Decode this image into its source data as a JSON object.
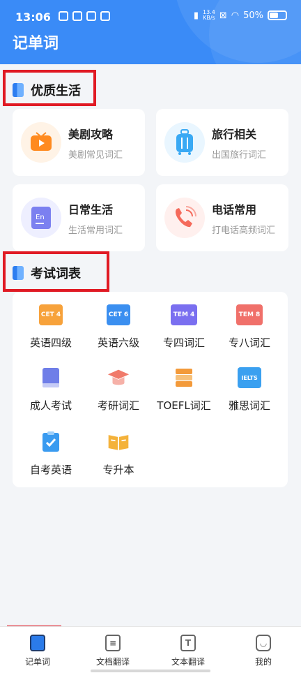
{
  "status": {
    "time": "13:06",
    "speed_top": "13.4",
    "speed_unit": "KB/s",
    "battery": "50%"
  },
  "app_title": "记单词",
  "section_quality": {
    "title": "优质生活"
  },
  "cards": [
    {
      "title": "美剧攻略",
      "subtitle": "美剧常见词汇",
      "icon": "tv-play-icon",
      "bg": "#fff3e6",
      "accent": "#ff8a1f"
    },
    {
      "title": "旅行相关",
      "subtitle": "出国旅行词汇",
      "icon": "suitcase-icon",
      "bg": "#e9f6ff",
      "accent": "#39a9f4"
    },
    {
      "title": "日常生活",
      "subtitle": "生活常用词汇",
      "icon": "book-en-icon",
      "bg": "#eeefff",
      "accent": "#7b80f0"
    },
    {
      "title": "电话常用",
      "subtitle": "打电话高频词汇",
      "icon": "phone-icon",
      "bg": "#fff0ee",
      "accent": "#f56a5b"
    }
  ],
  "section_exam": {
    "title": "考试词表"
  },
  "exam_items": [
    {
      "label": "英语四级",
      "badge": "CET 4",
      "icon": "cet4-icon",
      "color": "#f7a23b"
    },
    {
      "label": "英语六级",
      "badge": "CET 6",
      "icon": "cet6-icon",
      "color": "#3b8ff0"
    },
    {
      "label": "专四词汇",
      "badge": "TEM 4",
      "icon": "tem4-icon",
      "color": "#7a6ff0"
    },
    {
      "label": "专八词汇",
      "badge": "TEM 8",
      "icon": "tem8-icon",
      "color": "#f0706a"
    },
    {
      "label": "成人考试",
      "badge": "",
      "icon": "book-icon",
      "color": "#6f7ee8"
    },
    {
      "label": "考研词汇",
      "badge": "",
      "icon": "graduation-cap-icon",
      "color": "#f07a6a"
    },
    {
      "label": "TOEFL词汇",
      "badge": "",
      "icon": "books-stack-icon",
      "color": "#f39a3a"
    },
    {
      "label": "雅思词汇",
      "badge": "IELTS",
      "icon": "ielts-icon",
      "color": "#3aa0f0"
    },
    {
      "label": "自考英语",
      "badge": "",
      "icon": "checklist-icon",
      "color": "#3a9bf0"
    },
    {
      "label": "专升本",
      "badge": "",
      "icon": "open-book-icon",
      "color": "#f4b23a"
    }
  ],
  "tabs": [
    {
      "label": "记单词",
      "icon": "book-tab-icon",
      "glyph": ""
    },
    {
      "label": "文档翻译",
      "icon": "document-icon",
      "glyph": "≡"
    },
    {
      "label": "文本翻译",
      "icon": "text-t-icon",
      "glyph": "T"
    },
    {
      "label": "我的",
      "icon": "smile-icon",
      "glyph": "◡"
    }
  ]
}
